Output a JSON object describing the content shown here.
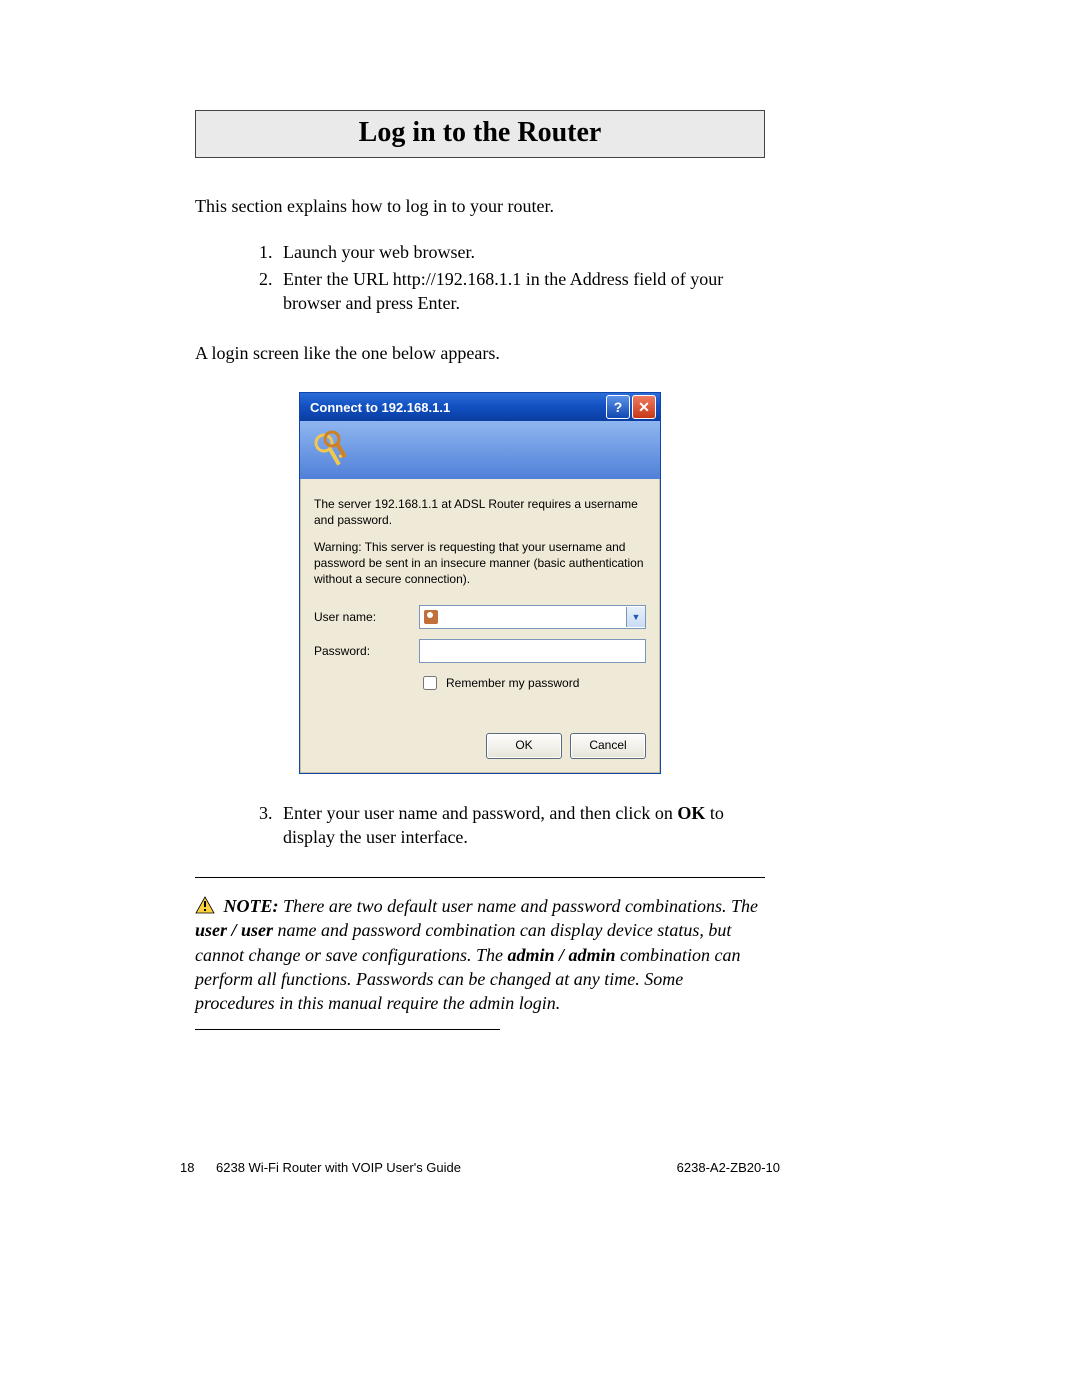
{
  "heading": "Log in to the Router",
  "intro": "This section explains how to log in to your router.",
  "step1": "Launch your web browser.",
  "step2": "Enter the URL http://192.168.1.1 in the Address field of your browser and press Enter.",
  "appears": "A login screen like the one below appears.",
  "dialog": {
    "title": "Connect to 192.168.1.1",
    "help": "?",
    "close": "✕",
    "server_msg": "The server 192.168.1.1 at ADSL Router requires a username and password.",
    "warn_msg": "Warning: This server is requesting that your username and password be sent in an insecure manner (basic authentication without a secure connection).",
    "username_label": "User name:",
    "password_label": "Password:",
    "remember_label": "Remember my password",
    "ok": "OK",
    "cancel": "Cancel",
    "chevron": "▼"
  },
  "step3_a": "Enter your user name and password, and then click on ",
  "step3_ok": "OK",
  "step3_b": " to display the user interface.",
  "note": {
    "label": "NOTE:  ",
    "t1": "There are two default user name and password combinations. The ",
    "c1": "user / user",
    "t2": " name and password combination can display device status, but cannot change or save configurations. The ",
    "c2": "admin / admin",
    "t3": " combination can perform all functions. Passwords can be changed at any time.  Some procedures in this manual require the admin login."
  },
  "footer": {
    "page": "18",
    "mid": "6238 Wi-Fi Router with VOIP User's Guide",
    "right": "6238-A2-ZB20-10"
  }
}
